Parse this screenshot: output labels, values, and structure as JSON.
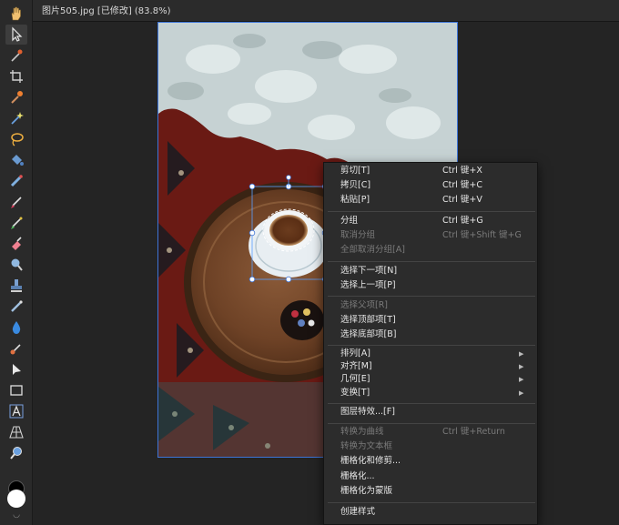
{
  "document_tab": {
    "title": "图片505.jpg [已修改] (83.8%)"
  },
  "toolbar": {
    "tools": [
      {
        "name": "hand-tool",
        "icon": "hand-icon"
      },
      {
        "name": "move-tool",
        "icon": "pointer-icon"
      },
      {
        "name": "color-picker-tool",
        "icon": "eyedropper-icon"
      },
      {
        "name": "crop-tool",
        "icon": "crop-icon"
      },
      {
        "name": "selection-brush-tool",
        "icon": "selection-brush-icon"
      },
      {
        "name": "magic-wand-tool",
        "icon": "magic-wand-icon"
      },
      {
        "name": "lasso-tool",
        "icon": "lasso-icon"
      },
      {
        "name": "flood-fill-tool",
        "icon": "bucket-icon"
      },
      {
        "name": "gradient-tool",
        "icon": "gradient-icon"
      },
      {
        "name": "paint-brush-tool",
        "icon": "brush-icon"
      },
      {
        "name": "mixer-brush-tool",
        "icon": "mixer-brush-icon"
      },
      {
        "name": "erase-brush-tool",
        "icon": "eraser-icon"
      },
      {
        "name": "dodge-tool",
        "icon": "dodge-icon"
      },
      {
        "name": "clone-tool",
        "icon": "stamp-icon"
      },
      {
        "name": "healing-tool",
        "icon": "healing-icon"
      },
      {
        "name": "blur-tool",
        "icon": "droplet-icon"
      },
      {
        "name": "smudge-tool",
        "icon": "smudge-icon"
      },
      {
        "name": "node-tool",
        "icon": "node-icon"
      },
      {
        "name": "rectangle-tool",
        "icon": "rectangle-icon"
      },
      {
        "name": "artistic-text-tool",
        "icon": "text-icon"
      },
      {
        "name": "perspective-tool",
        "icon": "perspective-icon"
      },
      {
        "name": "zoom-tool",
        "icon": "zoom-icon"
      }
    ],
    "colors": {
      "primary": "#ffffff",
      "secondary": "#000000"
    }
  },
  "context_menu": {
    "items": [
      {
        "label": "剪切[T]",
        "shortcut": "Ctrl 键+X",
        "disabled": false
      },
      {
        "label": "拷贝[C]",
        "shortcut": "Ctrl 键+C",
        "disabled": false
      },
      {
        "label": "粘贴[P]",
        "shortcut": "Ctrl 键+V",
        "disabled": false
      },
      {
        "label": "分组",
        "shortcut": "Ctrl 键+G",
        "disabled": false
      },
      {
        "label": "取消分组",
        "shortcut": "Ctrl 键+Shift 键+G",
        "disabled": true
      },
      {
        "label": "全部取消分组[A]",
        "shortcut": "",
        "disabled": true
      },
      {
        "label": "选择下一项[N]",
        "shortcut": "",
        "disabled": false
      },
      {
        "label": "选择上一项[P]",
        "shortcut": "",
        "disabled": false
      },
      {
        "label": "选择父项[R]",
        "shortcut": "",
        "disabled": true
      },
      {
        "label": "选择顶部项[T]",
        "shortcut": "",
        "disabled": false
      },
      {
        "label": "选择底部项[B]",
        "shortcut": "",
        "disabled": false
      },
      {
        "label": "排列[A]",
        "shortcut": "",
        "disabled": false,
        "submenu": true
      },
      {
        "label": "对齐[M]",
        "shortcut": "",
        "disabled": false,
        "submenu": true
      },
      {
        "label": "几何[E]",
        "shortcut": "",
        "disabled": false,
        "submenu": true
      },
      {
        "label": "变换[T]",
        "shortcut": "",
        "disabled": false,
        "submenu": true
      },
      {
        "label": "图层特效...[F]",
        "shortcut": "",
        "disabled": false
      },
      {
        "label": "转换为曲线",
        "shortcut": "Ctrl 键+Return",
        "disabled": true
      },
      {
        "label": "转换为文本框",
        "shortcut": "",
        "disabled": true
      },
      {
        "label": "栅格化和修剪...",
        "shortcut": "",
        "disabled": false
      },
      {
        "label": "栅格化...",
        "shortcut": "",
        "disabled": false
      },
      {
        "label": "栅格化为蒙版",
        "shortcut": "",
        "disabled": false
      },
      {
        "label": "创建样式",
        "shortcut": "",
        "disabled": false
      }
    ]
  },
  "colors": {
    "accent": "#3d74d6",
    "menu_bg": "#2c2c2c",
    "disabled_text": "#7a7a7a"
  }
}
